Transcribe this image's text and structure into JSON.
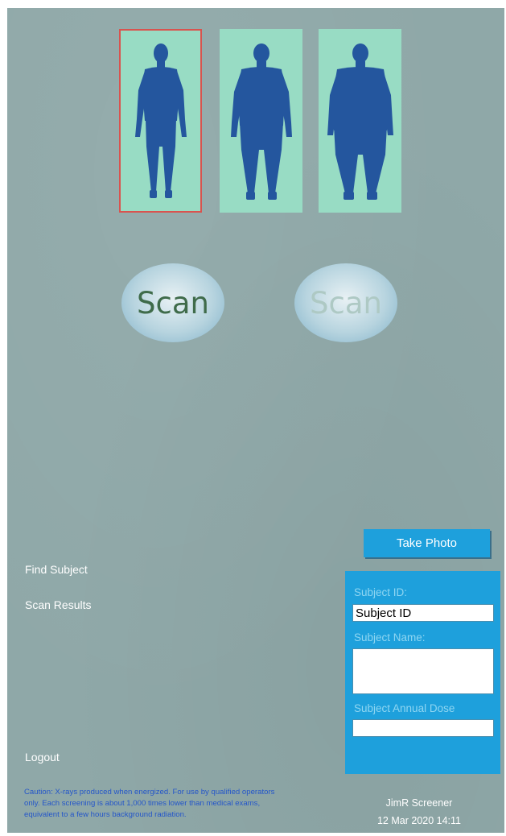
{
  "body_types": [
    {
      "name": "slim",
      "selected": true
    },
    {
      "name": "medium",
      "selected": false
    },
    {
      "name": "large",
      "selected": false
    }
  ],
  "scan_buttons": [
    {
      "label": "Scan",
      "state": "active"
    },
    {
      "label": "Scan",
      "state": "disabled"
    }
  ],
  "nav": {
    "find_subject": "Find Subject",
    "scan_results": "Scan Results",
    "logout": "Logout"
  },
  "take_photo_label": "Take Photo",
  "subject": {
    "id_label": "Subject ID:",
    "id_value": "Subject ID",
    "name_label": "Subject Name:",
    "name_value": "",
    "dose_label": "Subject Annual Dose",
    "dose_value": ""
  },
  "caution": "Caution: X-rays produced when energized.  For use by qualified operators only.  Each screening is about 1,000 times lower than medical exams, equivalent to a few hours background radiation.",
  "footer": {
    "user": "JimR Screener",
    "datetime": "12 Mar 2020 14:11"
  },
  "colors": {
    "background": "#8fa8a8",
    "card": "#98dcc4",
    "selected_border": "#d9534f",
    "silhouette": "#24569e",
    "panel": "#1ea0dc",
    "caution_text": "#2456c9"
  }
}
